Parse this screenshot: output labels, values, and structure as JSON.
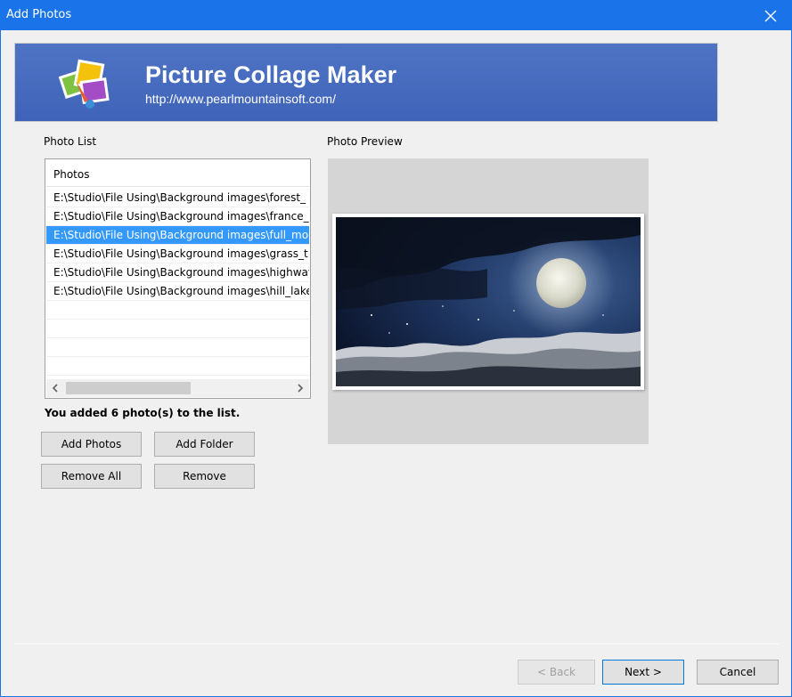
{
  "window": {
    "title": "Add Photos",
    "accent_color": "#1a73e8"
  },
  "banner": {
    "title": "Picture Collage Maker",
    "url": "http://www.pearlmountainsoft.com/"
  },
  "photo_list": {
    "label": "Photo List",
    "column_header": "Photos",
    "rows": [
      "E:\\Studio\\File Using\\Background images\\forest_",
      "E:\\Studio\\File Using\\Background images\\france_",
      "E:\\Studio\\File Using\\Background images\\full_moo",
      "E:\\Studio\\File Using\\Background images\\grass_t",
      "E:\\Studio\\File Using\\Background images\\highway",
      "E:\\Studio\\File Using\\Background images\\hill_lake"
    ],
    "selected_index": 2
  },
  "status": "You added 6 photo(s) to the list.",
  "buttons": {
    "add_photos": "Add Photos",
    "add_folder": "Add Folder",
    "remove_all": "Remove All",
    "remove": "Remove",
    "back": "< Back",
    "next": "Next >",
    "cancel": "Cancel"
  },
  "preview": {
    "label": "Photo Preview"
  },
  "icons": {
    "close": "close-icon",
    "logo": "collage-logo-icon",
    "scroll_left": "chevron-left-icon",
    "scroll_right": "chevron-right-icon"
  }
}
